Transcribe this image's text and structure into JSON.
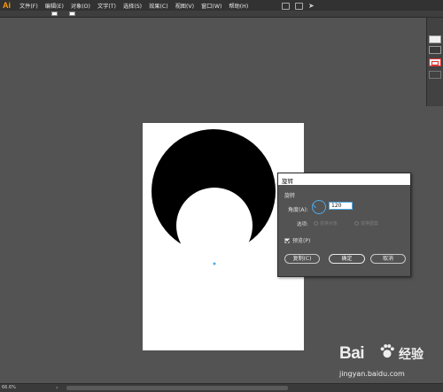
{
  "app": {
    "logo": "Ai"
  },
  "menu": [
    {
      "label": "文件(F)"
    },
    {
      "label": "编辑(E)"
    },
    {
      "label": "对象(O)"
    },
    {
      "label": "文字(T)"
    },
    {
      "label": "选择(S)"
    },
    {
      "label": "效果(C)"
    },
    {
      "label": "视图(V)"
    },
    {
      "label": "窗口(W)"
    },
    {
      "label": "帮助(H)"
    }
  ],
  "dialog": {
    "title": "旋转",
    "section": "旋转",
    "angle_label": "角度(A):",
    "angle_value": "120",
    "options_label": "选项:",
    "opt_transform_objects": "变换对象",
    "opt_transform_patterns": "变换图案",
    "preview_label": "预览(P)",
    "preview_checked": true,
    "copy_label": "复制(C)",
    "ok_label": "确定",
    "cancel_label": "取消"
  },
  "status": {
    "zoom": "66.6%"
  },
  "watermark": {
    "brand": "Bai",
    "brand_cn": "经验",
    "url": "jingyan.baidu.com"
  },
  "colors": {
    "accent": "#4ea9e8",
    "logo": "#ff9a00",
    "workspace": "#535353"
  }
}
